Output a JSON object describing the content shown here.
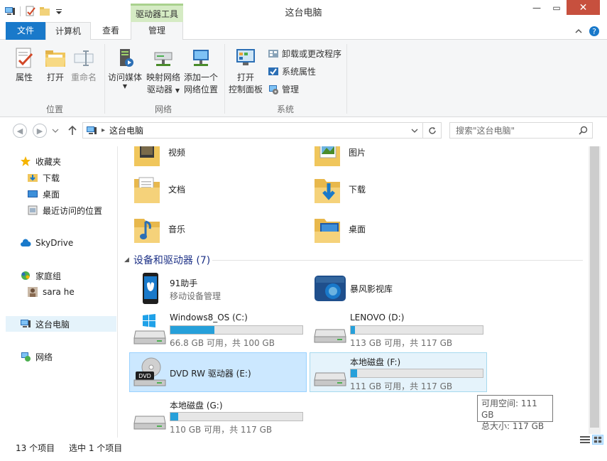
{
  "window": {
    "title": "这台电脑",
    "context_tab": "驱动器工具",
    "close_glyph": "✕",
    "min_glyph": "—",
    "max_glyph": "▭"
  },
  "ribbon_tabs": {
    "file": "文件",
    "computer": "计算机",
    "view": "查看",
    "manage": "管理"
  },
  "ribbon": {
    "location": {
      "properties": "属性",
      "open": "打开",
      "rename": "重命名",
      "label": "位置"
    },
    "network": {
      "access_media_1": "访问媒体",
      "map_drive_1": "映射网络",
      "map_drive_2": "驱动器",
      "add_location_1": "添加一个",
      "add_location_2": "网络位置",
      "label": "网络"
    },
    "system": {
      "open_cp_1": "打开",
      "open_cp_2": "控制面板",
      "uninstall": "卸载或更改程序",
      "sys_props": "系统属性",
      "manage": "管理",
      "label": "系统"
    }
  },
  "address": {
    "path": "这台电脑",
    "search_placeholder": "搜索\"这台电脑\""
  },
  "nav": {
    "favorites": "收藏夹",
    "downloads": "下载",
    "desktop": "桌面",
    "recent": "最近访问的位置",
    "skydrive": "SkyDrive",
    "homegroup": "家庭组",
    "user": "sara he",
    "this_pc": "这台电脑",
    "network": "网络"
  },
  "folders": {
    "videos": "视频",
    "pictures": "图片",
    "documents": "文档",
    "downloads": "下载",
    "music": "音乐",
    "desktop": "桌面"
  },
  "section": {
    "devices": "设备和驱动器 (7)"
  },
  "devices": {
    "assistant_name": "91助手",
    "assistant_sub": "移动设备管理",
    "storm_name": "暴风影视库"
  },
  "drives": [
    {
      "name": "Windows8_OS (C:)",
      "sub": "66.8 GB 可用，共 100 GB",
      "used_fraction": 0.332
    },
    {
      "name": "LENOVO (D:)",
      "sub": "113 GB 可用，共 117 GB",
      "used_fraction": 0.034
    },
    {
      "name": "DVD RW 驱动器 (E:)",
      "sub": ""
    },
    {
      "name": "本地磁盘 (F:)",
      "sub": "111 GB 可用，共 117 GB",
      "used_fraction": 0.051
    },
    {
      "name": "本地磁盘 (G:)",
      "sub": "110 GB 可用，共 117 GB",
      "used_fraction": 0.06
    }
  ],
  "tooltip": {
    "line1": "可用空间: 111 GB",
    "line2": "总大小: 117 GB"
  },
  "status": {
    "count": "13 个项目",
    "selected": "选中 1 个项目"
  },
  "colors": {
    "accent": "#1979ca",
    "bar_fill": "#26a0da",
    "close": "#c7503e",
    "context": "#d5ebc4"
  }
}
